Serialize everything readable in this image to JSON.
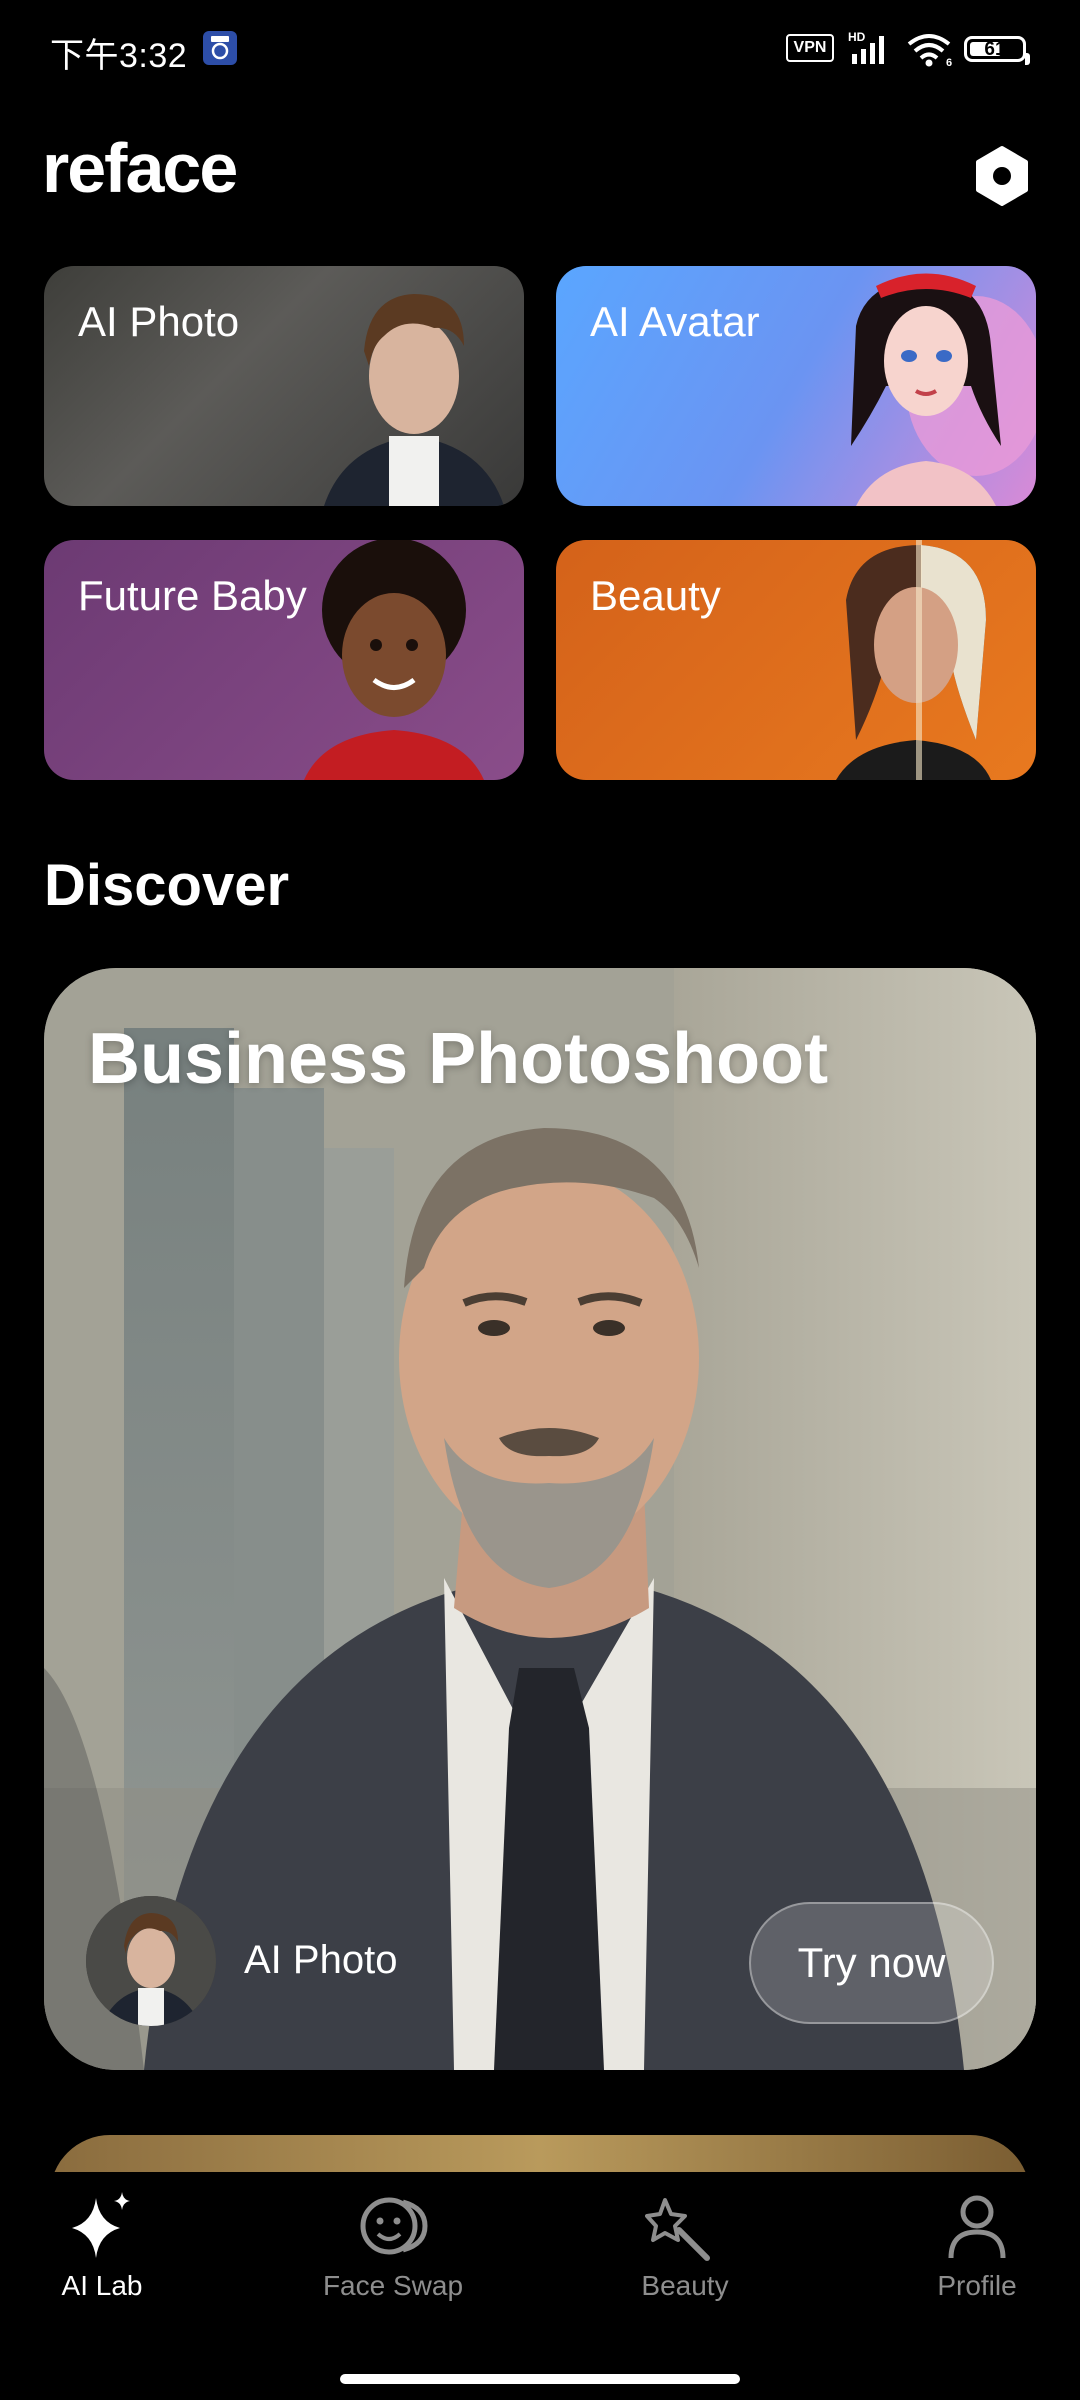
{
  "status_bar": {
    "time": "下午3:32",
    "vpn": "VPN",
    "network": "HD",
    "wifi_badge": "6",
    "battery": "61",
    "battery_level": 0.61
  },
  "header": {
    "logo": "reface"
  },
  "categories": [
    {
      "label": "AI Photo"
    },
    {
      "label": "AI Avatar"
    },
    {
      "label": "Future Baby"
    },
    {
      "label": "Beauty"
    }
  ],
  "discover": {
    "title": "Discover",
    "card": {
      "title": "Business Photoshoot",
      "source": "AI Photo",
      "cta": "Try now"
    }
  },
  "nav": {
    "items": [
      {
        "label": "AI Lab",
        "icon": "sparkle-icon",
        "active": true
      },
      {
        "label": "Face Swap",
        "icon": "face-swap-icon",
        "active": false
      },
      {
        "label": "Beauty",
        "icon": "magic-wand-icon",
        "active": false
      },
      {
        "label": "Profile",
        "icon": "person-icon",
        "active": false
      }
    ]
  },
  "colors": {
    "background": "#000000",
    "nav_active": "#ffffff",
    "nav_inactive": "#8e8e8e",
    "tile_ai_photo": "#4a4a47",
    "tile_ai_avatar": "#5aa6ff",
    "tile_future_baby": "#7a4580",
    "tile_beauty": "#e06d1d"
  }
}
